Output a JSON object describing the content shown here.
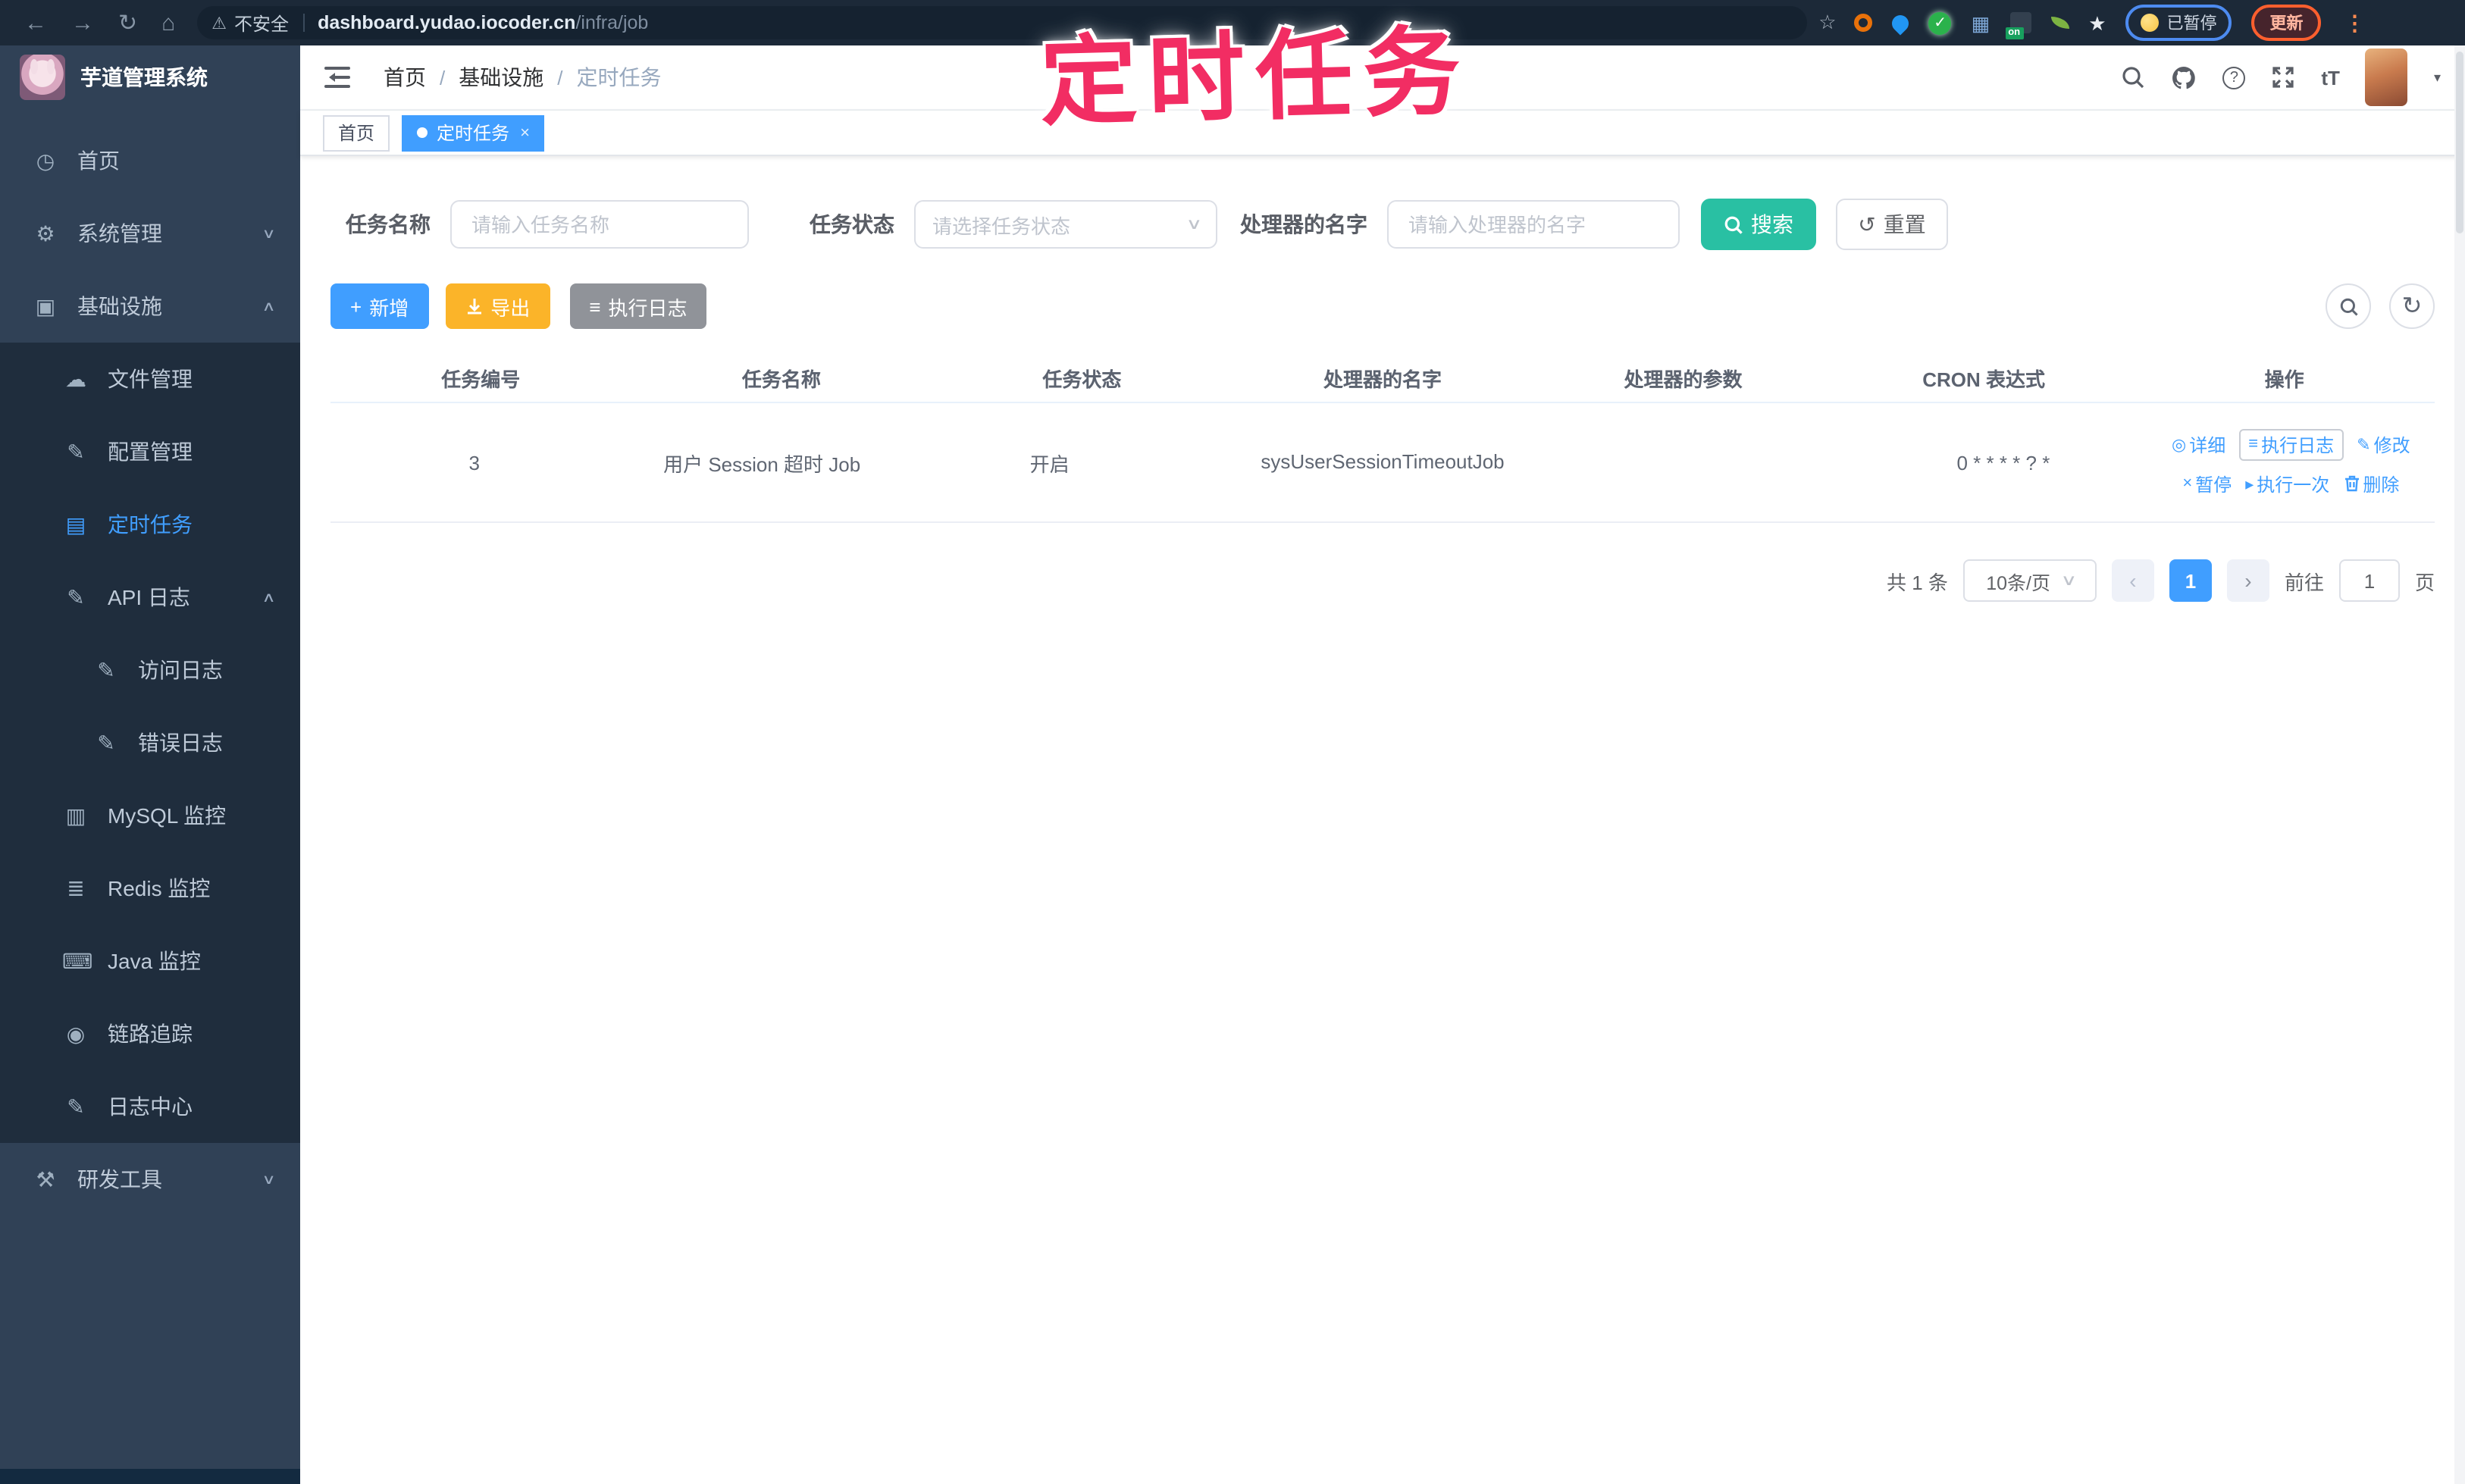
{
  "browser": {
    "security_label": "不安全",
    "url_host": "dashboard.yudao.iocoder.cn",
    "url_path": "/infra/job",
    "ext_on_badge": "on",
    "paused_chip": "已暂停",
    "update_button": "更新"
  },
  "watermark": "定时任务",
  "sidebar": {
    "title": "芋道管理系统",
    "items": [
      {
        "label": "首页"
      },
      {
        "label": "系统管理"
      },
      {
        "label": "基础设施"
      },
      {
        "label": "文件管理"
      },
      {
        "label": "配置管理"
      },
      {
        "label": "定时任务"
      },
      {
        "label": "API 日志"
      },
      {
        "label": "访问日志"
      },
      {
        "label": "错误日志"
      },
      {
        "label": "MySQL 监控"
      },
      {
        "label": "Redis 监控"
      },
      {
        "label": "Java 监控"
      },
      {
        "label": "链路追踪"
      },
      {
        "label": "日志中心"
      },
      {
        "label": "研发工具"
      }
    ]
  },
  "header": {
    "breadcrumb": [
      "首页",
      "基础设施",
      "定时任务"
    ]
  },
  "tabs": [
    {
      "label": "首页"
    },
    {
      "label": "定时任务"
    }
  ],
  "filters": {
    "name_label": "任务名称",
    "name_placeholder": "请输入任务名称",
    "status_label": "任务状态",
    "status_placeholder": "请选择任务状态",
    "handler_label": "处理器的名字",
    "handler_placeholder": "请输入处理器的名字",
    "search": "搜索",
    "reset": "重置"
  },
  "toolbar": {
    "add": "新增",
    "export": "导出",
    "exec_log": "执行日志"
  },
  "table": {
    "columns": [
      "任务编号",
      "任务名称",
      "任务状态",
      "处理器的名字",
      "处理器的参数",
      "CRON 表达式",
      "操作"
    ],
    "rows": [
      {
        "id": "3",
        "name": "用户 Session 超时 Job",
        "status": "开启",
        "handler": "sysUserSessionTimeoutJob",
        "param": "",
        "cron": "0 * * * * ? *"
      }
    ],
    "row_actions": [
      "详细",
      "执行日志",
      "修改",
      "暂停",
      "执行一次",
      "删除"
    ]
  },
  "pagination": {
    "total": "共 1 条",
    "page_size": "10条/页",
    "current": "1",
    "goto_label": "前往",
    "goto_value": "1",
    "page_label": "页"
  },
  "icons": {
    "back": "←",
    "forward": "→",
    "reload": "↻",
    "home": "⌂",
    "warning": "⚠",
    "bookmark_star": "☆",
    "ext_grid": "▦",
    "ext_star": "★",
    "menu_dots": "⋮",
    "check": "✓",
    "dashboard": "◷",
    "gear": "⚙",
    "infra": "▣",
    "cloud": "☁",
    "edit": "✎",
    "task": "▤",
    "db": "▥",
    "layers": "≣",
    "java": "⌨",
    "eye": "◉",
    "tools": "⚒",
    "chev_down": "∨",
    "chev_up": "∧",
    "plus": "+",
    "list": "≡",
    "detail": "◎",
    "close": "×",
    "play": "▸",
    "refresh": "↺",
    "caret": "▾",
    "prev": "‹",
    "next": "›"
  }
}
